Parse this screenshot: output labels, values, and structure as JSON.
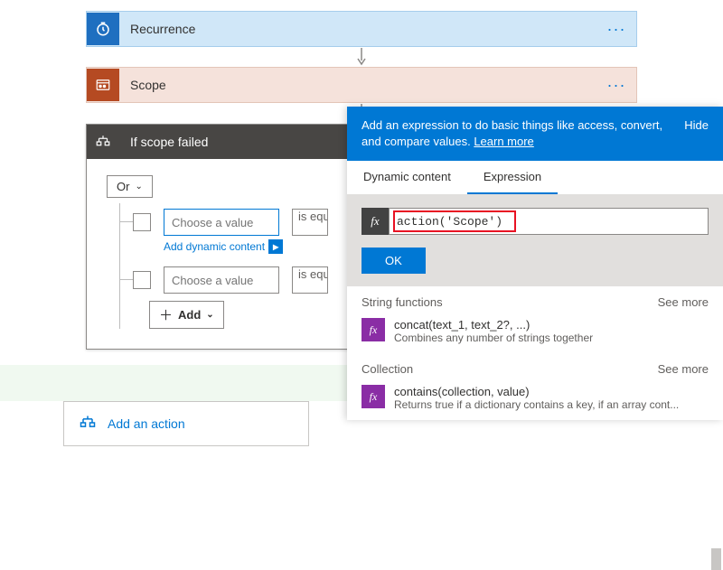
{
  "cards": {
    "recurrence": {
      "title": "Recurrence"
    },
    "scope": {
      "title": "Scope"
    }
  },
  "condition": {
    "title": "If scope failed",
    "group_op": "Or",
    "value_placeholder": "Choose a value",
    "op_label": "is equal to",
    "dynamic_link": "Add dynamic content",
    "add_label": "Add"
  },
  "add_action": "Add an action",
  "panel": {
    "blurb": "Add an expression to do basic things like access, convert, and compare values.",
    "learn_more": "Learn more",
    "hide": "Hide",
    "tabs": {
      "dynamic": "Dynamic content",
      "expression": "Expression"
    },
    "expr_value": "action('Scope')",
    "ok": "OK",
    "sections": {
      "string": {
        "label": "String functions",
        "see": "See more"
      },
      "collection": {
        "label": "Collection",
        "see": "See more"
      }
    },
    "funcs": {
      "concat": {
        "sig": "concat(text_1, text_2?, ...)",
        "desc": "Combines any number of strings together"
      },
      "contains": {
        "sig": "contains(collection, value)",
        "desc": "Returns true if a dictionary contains a key, if an array cont..."
      }
    }
  }
}
